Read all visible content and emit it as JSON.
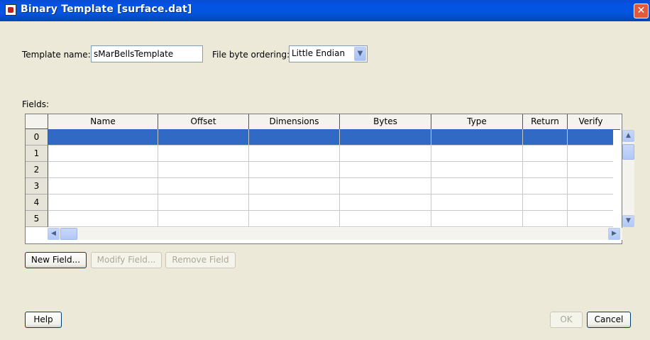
{
  "window": {
    "title": "Binary Template [surface.dat]"
  },
  "template": {
    "label": "Template name:",
    "value": "sMarBellsTemplate"
  },
  "byte_order": {
    "label": "File byte ordering:",
    "selected": "Little Endian"
  },
  "fields": {
    "label": "Fields:",
    "columns": [
      "Name",
      "Offset",
      "Dimensions",
      "Bytes",
      "Type",
      "Return",
      "Verify"
    ],
    "row_numbers": [
      "0",
      "1",
      "2",
      "3",
      "4",
      "5"
    ],
    "selected_row": 0
  },
  "buttons": {
    "new_field": "New Field...",
    "modify_field": "Modify Field...",
    "remove_field": "Remove Field",
    "help": "Help",
    "ok": "OK",
    "cancel": "Cancel"
  },
  "colors": {
    "selection": "#316ac5",
    "titlebar": "#0456e0",
    "close": "#e25a3c"
  }
}
